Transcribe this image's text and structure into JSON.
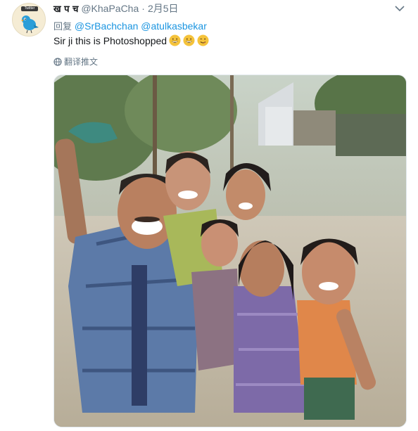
{
  "tweet": {
    "author": {
      "display_name": "ख प च",
      "handle": "@KhaPaCha",
      "avatar_text": "Twitter"
    },
    "separator": "·",
    "timestamp": "2月5日",
    "reply": {
      "prefix": "回复",
      "mentions": [
        "@SrBachchan",
        "@atulkasbekar"
      ]
    },
    "text": "Sir ji this is Photoshopped",
    "emojis": [
      "grinning-face-icon",
      "grinning-face-icon",
      "winking-face-icon"
    ],
    "translate_label": "翻译推文",
    "media": {
      "icon": "photo-selfie-group"
    }
  },
  "colors": {
    "link": "#1b95e0",
    "muted": "#657786",
    "text": "#14171a",
    "emoji": "#f5c33b"
  }
}
